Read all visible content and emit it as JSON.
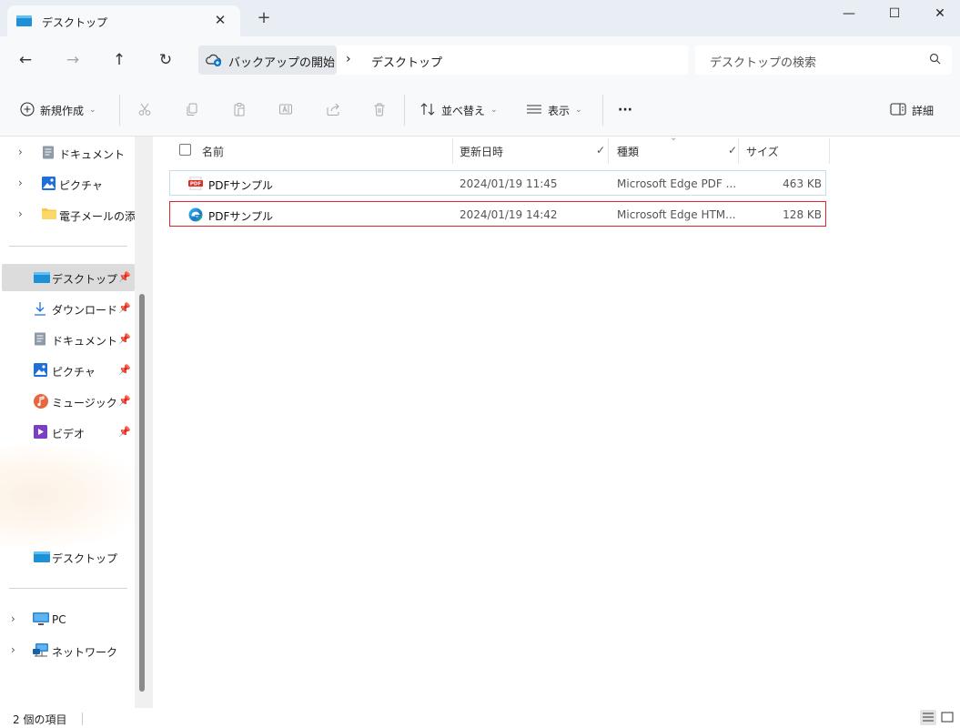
{
  "tab": {
    "title": "デスクトップ",
    "close": "✕",
    "new_tab": "+"
  },
  "window": {
    "minimize": "—",
    "maximize": "☐",
    "close": "✕"
  },
  "nav": {
    "back": "←",
    "forward": "→",
    "up": "↑",
    "refresh": "↻"
  },
  "address": {
    "root": "バックアップの開始",
    "separator": "›",
    "current": "デスクトップ"
  },
  "search": {
    "placeholder": "デスクトップの検索"
  },
  "toolbar": {
    "new_label": "新規作成",
    "sort_label": "並べ替え",
    "view_label": "表示",
    "more_label": "···",
    "details_label": "詳細"
  },
  "sidebar": {
    "tree_items": [
      {
        "label": "ドキュメント",
        "icon": "document-icon"
      },
      {
        "label": "ピクチャ",
        "icon": "pictures-icon"
      },
      {
        "label": "電子メールの添付",
        "icon": "folder-icon"
      }
    ],
    "quick_access": [
      {
        "label": "デスクトップ",
        "icon": "desktop-icon",
        "selected": true
      },
      {
        "label": "ダウンロード",
        "icon": "download-icon"
      },
      {
        "label": "ドキュメント",
        "icon": "document-icon"
      },
      {
        "label": "ピクチャ",
        "icon": "pictures-icon"
      },
      {
        "label": "ミュージック",
        "icon": "music-icon"
      },
      {
        "label": "ビデオ",
        "icon": "video-icon"
      }
    ],
    "desktop_label": "デスクトップ",
    "pc_label": "PC",
    "network_label": "ネットワーク"
  },
  "columns": {
    "name": "名前",
    "date": "更新日時",
    "type": "種類",
    "size": "サイズ"
  },
  "files": [
    {
      "name": "PDFサンプル",
      "date": "2024/01/19 11:45",
      "type": "Microsoft Edge PDF ...",
      "size": "463 KB",
      "icon": "pdf-file-icon"
    },
    {
      "name": "PDFサンプル",
      "date": "2024/01/19 14:42",
      "type": "Microsoft Edge HTM...",
      "size": "128 KB",
      "icon": "edge-html-file-icon"
    }
  ],
  "status": {
    "item_count": "2 個の項目"
  },
  "colors": {
    "accent": "#0078d4",
    "highlight_border": "#e5212a",
    "selected_bg": "#dcdcdc"
  }
}
